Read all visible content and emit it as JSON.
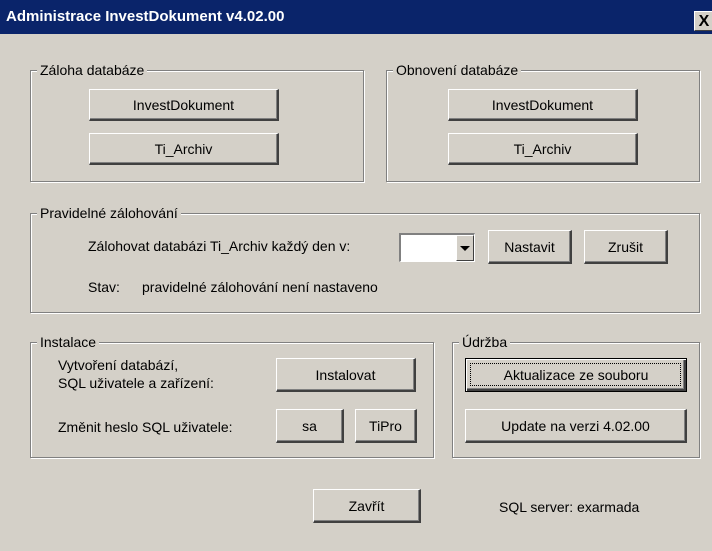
{
  "window": {
    "title": "Administrace InvestDokument v4.02.00",
    "close_label": "X"
  },
  "backup_group": {
    "legend": "Záloha databáze",
    "investdokument_button": "InvestDokument",
    "tiarchiv_button": "Ti_Archiv"
  },
  "restore_group": {
    "legend": "Obnovení databáze",
    "investdokument_button": "InvestDokument",
    "tiarchiv_button": "Ti_Archiv"
  },
  "scheduled_group": {
    "legend": "Pravidelné zálohování",
    "schedule_label": "Zálohovat databázi Ti_Archiv každý den v:",
    "time_select_value": "",
    "set_button": "Nastavit",
    "cancel_button": "Zrušit",
    "status_label": "Stav:",
    "status_text": "pravidelné zálohování není nastaveno"
  },
  "install_group": {
    "legend": "Instalace",
    "create_label_line1": "Vytvoření databází,",
    "create_label_line2": "SQL uživatele a zařízení:",
    "install_button": "Instalovat",
    "change_password_label": "Změnit heslo SQL uživatele:",
    "sa_button": "sa",
    "tipro_button": "TiPro"
  },
  "maintenance_group": {
    "legend": "Údržba",
    "update_from_file_button": "Aktualizace ze souboru",
    "update_version_button": "Update na verzi 4.02.00"
  },
  "footer": {
    "close_button": "Zavřít",
    "sql_server_text": "SQL server: exarmada"
  }
}
